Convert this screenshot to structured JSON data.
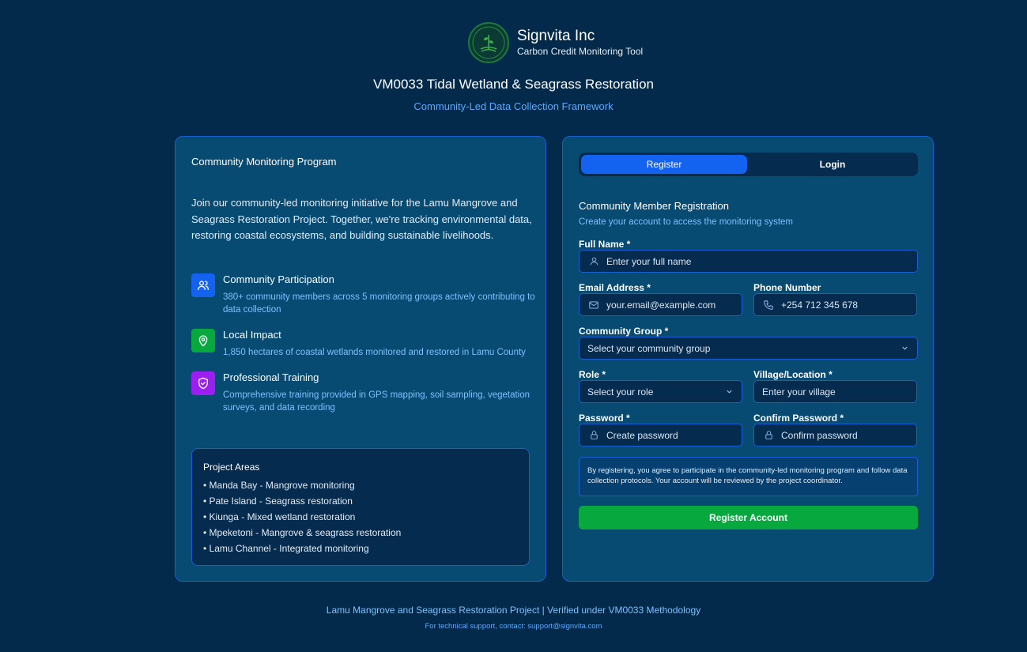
{
  "brand": {
    "name": "Signvita Inc",
    "tagline": "Carbon Credit Monitoring Tool",
    "logo_text": "SIGNVITA INC"
  },
  "header": {
    "title": "VM0033 Tidal Wetland & Seagrass Restoration",
    "subtitle": "Community-Led Data Collection Framework"
  },
  "program": {
    "title": "Community Monitoring Program",
    "intro": "Join our community-led monitoring initiative for the Lamu Mangrove and Seagrass Restoration Project. Together, we're tracking environmental data, restoring coastal ecosystems, and building sustainable livelihoods.",
    "features": [
      {
        "icon": "users-icon",
        "title": "Community Participation",
        "desc": "380+ community members across 5 monitoring groups actively contributing to data collection",
        "color": "#1463f0"
      },
      {
        "icon": "map-pin-icon",
        "title": "Local Impact",
        "desc": "1,850 hectares of coastal wetlands monitored and restored in Lamu County",
        "color": "#07a83e"
      },
      {
        "icon": "shield-check-icon",
        "title": "Professional Training",
        "desc": "Comprehensive training provided in GPS mapping, soil sampling, vegetation surveys, and data recording",
        "color": "#9b1ff0"
      }
    ],
    "areas_title": "Project Areas",
    "areas": [
      "• Manda Bay - Mangrove monitoring",
      "• Pate Island - Seagrass restoration",
      "• Kiunga - Mixed wetland restoration",
      "• Mpeketoni - Mangrove & seagrass restoration",
      "• Lamu Channel - Integrated monitoring"
    ]
  },
  "tabs": {
    "register": "Register",
    "login": "Login"
  },
  "form": {
    "title": "Community Member Registration",
    "subtitle": "Create your account to access the monitoring system",
    "full_name_label": "Full Name *",
    "full_name_placeholder": "Enter your full name",
    "email_label": "Email Address *",
    "email_placeholder": "your.email@example.com",
    "phone_label": "Phone Number",
    "phone_placeholder": "+254 712 345 678",
    "group_label": "Community Group *",
    "group_value": "Select your community group",
    "role_label": "Role *",
    "role_value": "Select your role",
    "village_label": "Village/Location *",
    "village_placeholder": "Enter your village",
    "password_label": "Password *",
    "password_placeholder": "Create password",
    "confirm_label": "Confirm Password *",
    "confirm_placeholder": "Confirm password",
    "notice": "By registering, you agree to participate in the community-led monitoring program and follow data collection protocols. Your account will be reviewed by the project coordinator.",
    "submit": "Register Account"
  },
  "footer": {
    "line1": "Lamu Mangrove and Seagrass Restoration Project | Verified under VM0033 Methodology",
    "line2": "For technical support, contact: support@signvita.com"
  },
  "colors": {
    "background": "#032a4a",
    "panel": "#074a72",
    "accent": "#1463f0",
    "success": "#07a83e",
    "link": "#7fc0ff"
  }
}
